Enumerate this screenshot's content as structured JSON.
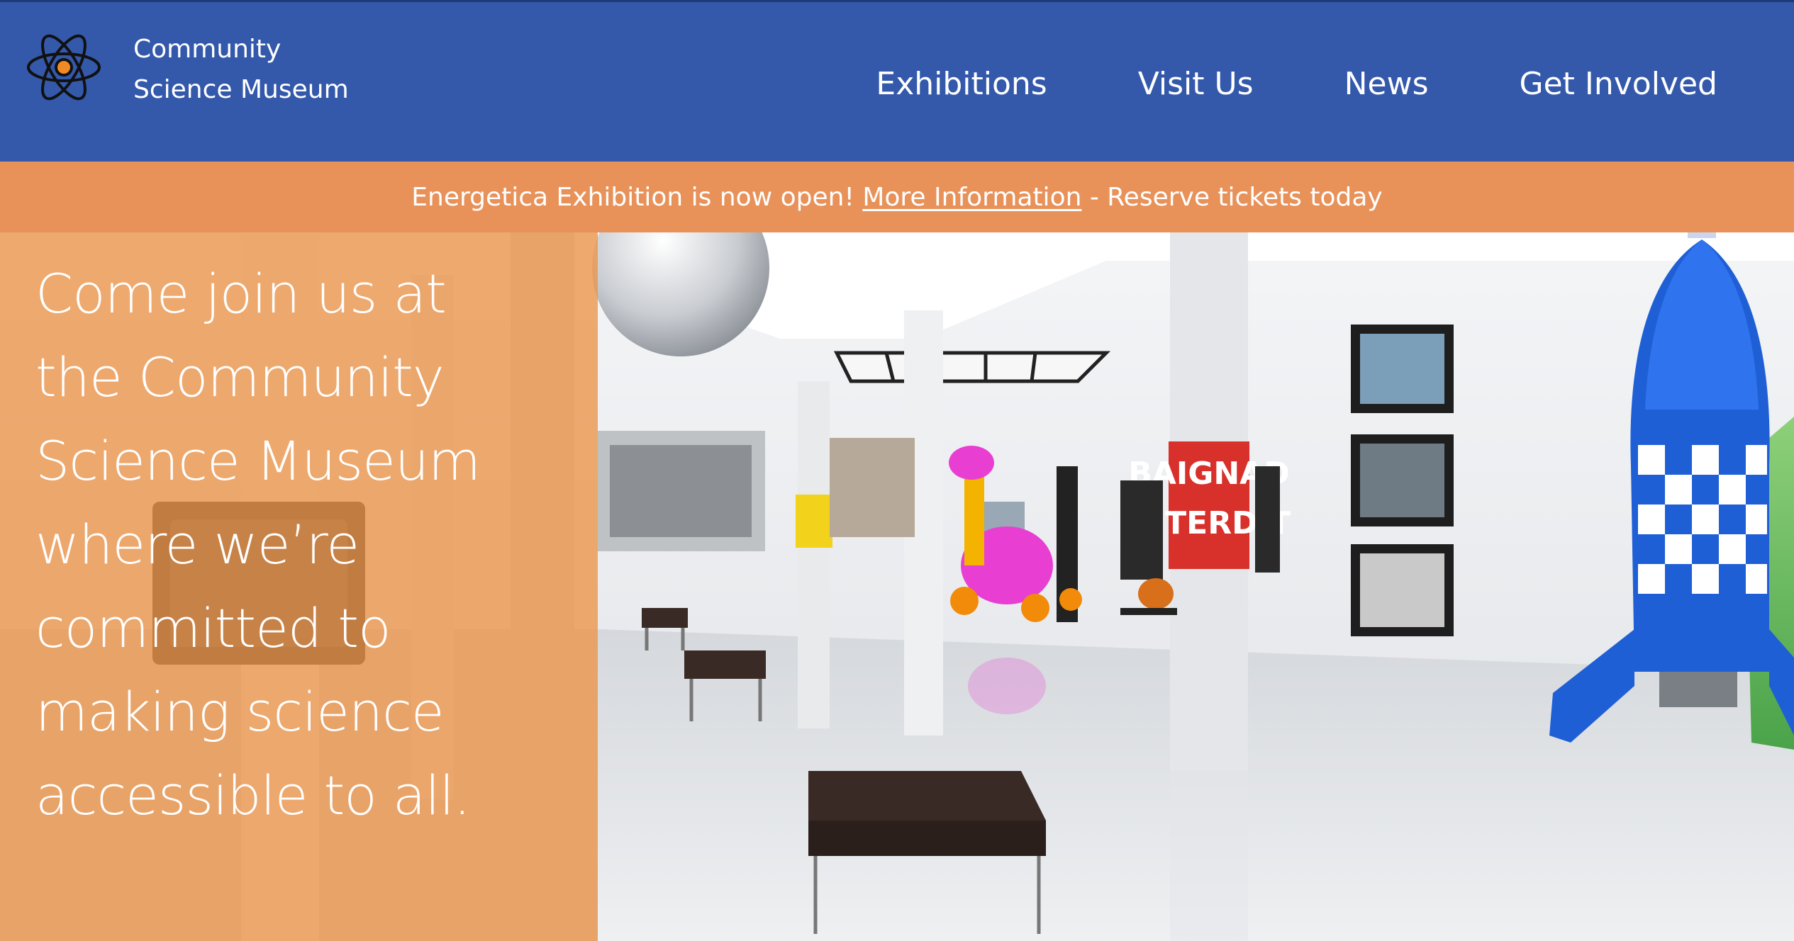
{
  "header": {
    "brand_line1": "Community",
    "brand_line2": "Science Museum",
    "logo_icon": "atom-icon",
    "nav": [
      {
        "label": "Exhibitions"
      },
      {
        "label": "Visit Us"
      },
      {
        "label": "News"
      },
      {
        "label": "Get Involved"
      }
    ]
  },
  "announcement": {
    "text_before": "Energetica Exhibition is now open! ",
    "link_label": "More Information",
    "text_after": " - Reserve tickets today"
  },
  "hero": {
    "headline": "Come join us at the Community Science Museum where we’re committed to making science accessible to all.",
    "image_alt": "museum-gallery-image"
  },
  "colors": {
    "header_bg": "#3459ab",
    "announcement_bg": "#e8925a",
    "hero_overlay": "#ec9448",
    "logo_accent": "#f08a24"
  }
}
